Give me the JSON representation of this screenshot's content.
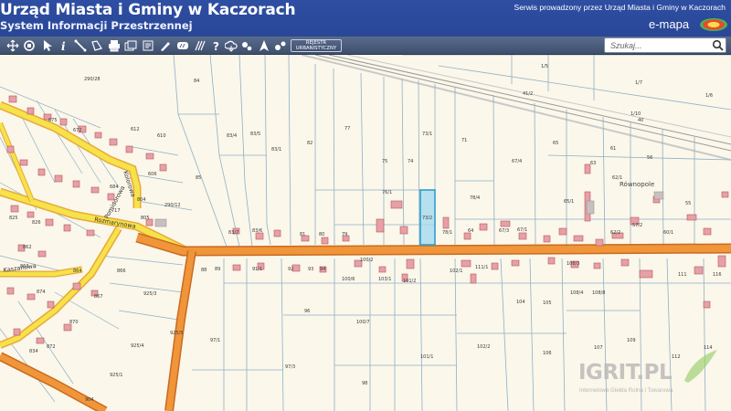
{
  "header": {
    "title": "Urząd Miasta i Gminy w Kaczorach",
    "subtitle": "System Informacji Przestrzennej",
    "provider": "Serwis prowadzony przez Urząd Miasta i Gminy w Kaczorach",
    "logo_text": "e-mapa"
  },
  "toolbar": {
    "tools": [
      "pan-icon",
      "zoom-window-icon",
      "pointer-icon",
      "info-icon",
      "measure-line-icon",
      "measure-area-icon",
      "print-icon",
      "layers-icon",
      "pdf-icon",
      "draw-icon",
      "hatch-icon",
      "help-icon",
      "cloud-icon",
      "search-plot-icon",
      "settings-icon",
      "north-icon",
      "point-info-icon"
    ],
    "rejestr_line1": "REJESTR",
    "rejestr_line2": "URBANISTYCZNY"
  },
  "search": {
    "placeholder": "Szukaj..."
  },
  "map": {
    "colors": {
      "background": "#fbf7ea",
      "main_road": "#f0953a",
      "local_road": "#f6e24a",
      "plot_line": "#8eb0c7",
      "building": "#e6a0a6",
      "highlight": "#9fd8ee"
    },
    "place_label": "Równopole",
    "streets": [
      "Kaszanowa",
      "Pomidorowa",
      "Kolorowa",
      "Rozmarynowa"
    ],
    "plots": {
      "p1": "290/28",
      "p2": "84",
      "p3": "83/4",
      "p4": "83/5",
      "p5": "83/1",
      "p6": "82",
      "p7": "77",
      "p8": "75",
      "p9": "74",
      "p10": "73/1",
      "p11": "73/2",
      "p12": "71",
      "p13": "67/4",
      "p14": "65",
      "p15": "61",
      "p16": "1/5",
      "p17": "1/7",
      "p18": "41/2",
      "p19": "1/10",
      "p20": "40",
      "p21": "1/6",
      "p22": "85",
      "p23": "290/12",
      "p24": "81",
      "p25": "80",
      "p26": "79",
      "p27": "78/4",
      "p28": "78/1",
      "p29": "64",
      "p30": "67/3",
      "p31": "67/1",
      "p32": "65/1",
      "p33": "62/1",
      "p34": "57/2",
      "p35": "55",
      "p36": "83/7",
      "p37": "83/6",
      "p38": "88",
      "p39": "91/1",
      "p40": "100/2",
      "p41": "100/6",
      "p42": "103/1",
      "p43": "101/2",
      "p44": "102/1",
      "p45": "96",
      "p46": "100/7",
      "p47": "97/1",
      "p48": "97/3",
      "p49": "98",
      "p50": "101/1",
      "p51": "102/2",
      "p52": "104",
      "p53": "105",
      "p54": "106",
      "p55": "107",
      "p56": "108/4",
      "p57": "108/3",
      "p58": "108/8",
      "p59": "109",
      "p60": "111",
      "p61": "112",
      "p62": "114",
      "p63": "116",
      "p64": "925/3",
      "p65": "925/4",
      "p66": "925/1",
      "p67": "925/5",
      "p68": "872",
      "p69": "870",
      "p70": "867",
      "p71": "866",
      "p72": "874",
      "p73": "834",
      "p74": "864",
      "p75": "825",
      "p76": "826",
      "p77": "862",
      "p78": "675",
      "p79": "672",
      "p80": "610",
      "p81": "612",
      "p82": "606",
      "p83": "684",
      "p84": "717",
      "p85": "805",
      "p86": "863",
      "p87": "804",
      "p88": "904",
      "p89": "94",
      "p90": "93",
      "p91": "89",
      "p92": "92",
      "p93": "62/2",
      "p94": "60/1",
      "p95": "63",
      "p96": "56",
      "p97": "76/1",
      "p98": "111/1"
    }
  },
  "watermark": {
    "brand": "IGRIT.PL",
    "tagline": "Internetowa Giełda Rolna i Towarowa"
  }
}
